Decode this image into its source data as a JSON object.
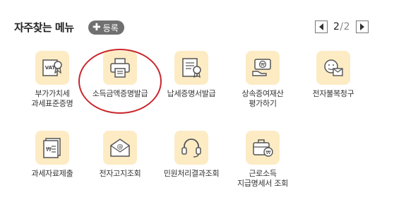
{
  "header": {
    "title": "자주찾는 메뉴",
    "register_label": "등록",
    "register_icon": "plus-icon",
    "pager": {
      "current": "2",
      "separator": "/",
      "total": "2"
    }
  },
  "menu": [
    {
      "label": "부가가치세\n과세표준증명",
      "icon": "vat-certificate-icon"
    },
    {
      "label": "소득금액증명발급",
      "icon": "printer-document-icon",
      "highlighted": true
    },
    {
      "label": "납세증명서발급",
      "icon": "certificate-seal-icon"
    },
    {
      "label": "상속증여재산\n평가하기",
      "icon": "hand-money-icon"
    },
    {
      "label": "전자불복청구",
      "icon": "face-message-icon"
    },
    {
      "label": "과세자료제출",
      "icon": "won-document-icon"
    },
    {
      "label": "전자고지조회",
      "icon": "email-envelope-icon"
    },
    {
      "label": "민원처리결과조회",
      "icon": "headset-icon"
    },
    {
      "label": "근로소득\n지급명세서 조회",
      "icon": "briefcase-won-icon"
    }
  ],
  "colors": {
    "icon_bg": "#fdebc4",
    "icon_stroke": "#555555",
    "highlight": "#c9252c",
    "button_bg": "#707070"
  }
}
